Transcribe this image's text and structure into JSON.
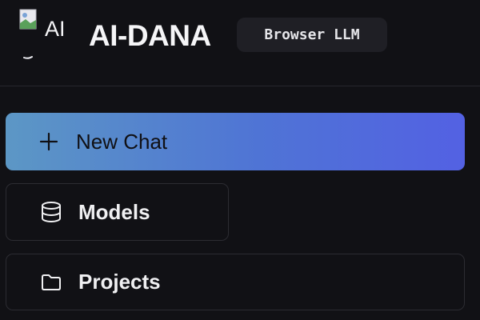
{
  "header": {
    "logo_alt": "AI",
    "title": "AI-DANA",
    "badge": "Browser LLM"
  },
  "nav": {
    "new_chat": {
      "label": "New Chat",
      "icon": "plus-icon"
    },
    "models": {
      "label": "Models",
      "icon": "database-icon"
    },
    "projects": {
      "label": "Projects",
      "icon": "folder-icon"
    }
  },
  "colors": {
    "background": "#111115",
    "gradient_start": "#5c97c5",
    "gradient_end": "#5361e3",
    "badge_bg": "#1f1f25"
  }
}
